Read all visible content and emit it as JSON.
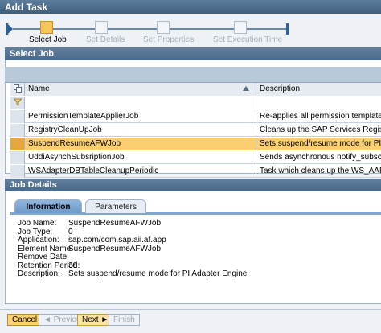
{
  "window": {
    "title": "Add Task"
  },
  "roadmap": {
    "steps": [
      {
        "label": "Select Job",
        "active": true
      },
      {
        "label": "Set  Details",
        "active": false
      },
      {
        "label": "Set Properties",
        "active": false
      },
      {
        "label": "Set Execution Time",
        "active": false
      }
    ]
  },
  "select_job": {
    "title": "Select Job",
    "columns": {
      "name": "Name",
      "description": "Description"
    },
    "rows": [
      {
        "name": "PermissionTemplateApplierJob",
        "description": "Re-applies all permission templates to existin"
      },
      {
        "name": "RegistryCleanUpJob",
        "description": "Cleans up the SAP Services Registry (SR)"
      },
      {
        "name": "SuspendResumeAFWJob",
        "description": "Sets suspend/resume mode for PI Adapter",
        "selected": true
      },
      {
        "name": "UddiAsynchSubsriptionJob",
        "description": "Sends asynchronous notify_subscriptionL"
      },
      {
        "name": "WSAdapterDBTableCleanupPeriodic",
        "description": "Task which cleans up the WS_AAE adapte"
      }
    ]
  },
  "job_details": {
    "title": "Job Details",
    "tabs": [
      "Information",
      "Parameters"
    ],
    "fields": [
      {
        "label": "Job Name:",
        "value": "SuspendResumeAFWJob"
      },
      {
        "label": "Job Type:",
        "value": "0"
      },
      {
        "label": "Application:",
        "value": "sap.com/com.sap.aii.af.app"
      },
      {
        "label": "Element Name:",
        "value": "SuspendResumeAFWJob"
      },
      {
        "label": "Remove Date:",
        "value": ""
      },
      {
        "label": "Retention Period:",
        "value": "30"
      },
      {
        "label": "Description:",
        "value": "Sets suspend/resume mode for PI Adapter Engine"
      }
    ]
  },
  "footer": {
    "cancel": "Cancel",
    "previous": "◄ Previous",
    "next": "Next ►",
    "finish": "Finish"
  }
}
